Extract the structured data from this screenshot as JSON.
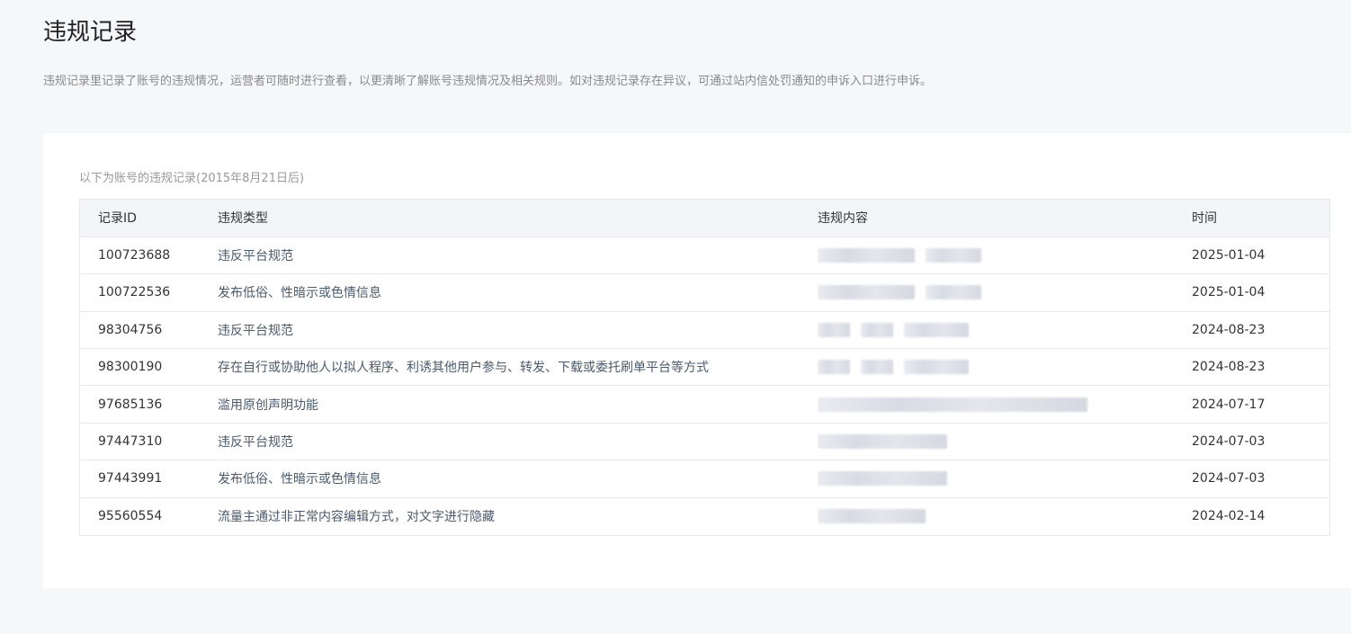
{
  "page": {
    "title": "违规记录",
    "description": "违规记录里记录了账号的违规情况，运营者可随时进行查看，以更清晰了解账号违规情况及相关规则。如对违规记录存在异议，可通过站内信处罚通知的申诉入口进行申诉。"
  },
  "table": {
    "caption": "以下为账号的违规记录(2015年8月21日后)",
    "headers": {
      "id": "记录ID",
      "type": "违规类型",
      "content": "违规内容",
      "time": "时间"
    },
    "rows": [
      {
        "id": "100723688",
        "type": "违反平台规范",
        "time": "2025-01-04"
      },
      {
        "id": "100722536",
        "type": "发布低俗、性暗示或色情信息",
        "time": "2025-01-04"
      },
      {
        "id": "98304756",
        "type": "违反平台规范",
        "time": "2024-08-23"
      },
      {
        "id": "98300190",
        "type": "存在自行或协助他人以拟人程序、利诱其他用户参与、转发、下载或委托刷单平台等方式",
        "time": "2024-08-23"
      },
      {
        "id": "97685136",
        "type": "滥用原创声明功能",
        "time": "2024-07-17"
      },
      {
        "id": "97447310",
        "type": "违反平台规范",
        "time": "2024-07-03"
      },
      {
        "id": "97443991",
        "type": "发布低俗、性暗示或色情信息",
        "time": "2024-07-03"
      },
      {
        "id": "95560554",
        "type": "流量主通过非正常内容编辑方式，对文字进行隐藏",
        "time": "2024-02-14"
      }
    ]
  }
}
